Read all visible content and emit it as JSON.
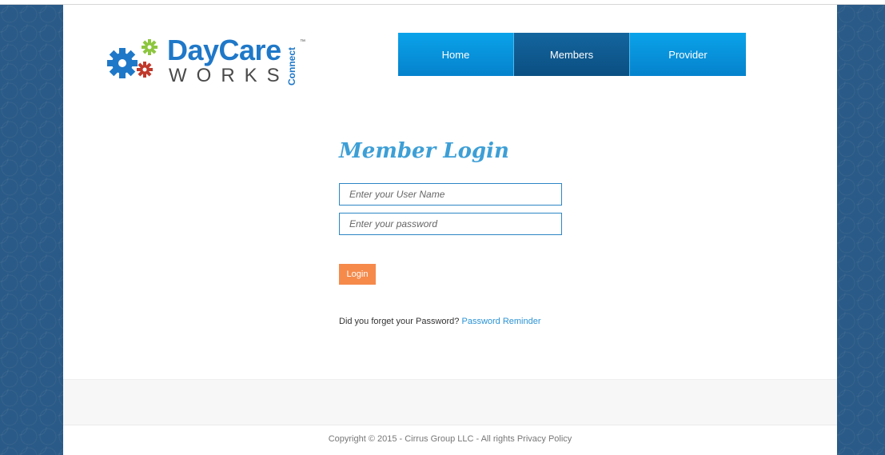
{
  "logo": {
    "brand_top": "DayCare",
    "brand_bottom": "WORKS",
    "brand_side": "Connect",
    "trademark": "™"
  },
  "nav": {
    "items": [
      {
        "label": "Home",
        "active": false
      },
      {
        "label": "Members",
        "active": true
      },
      {
        "label": "Provider",
        "active": false
      }
    ]
  },
  "login": {
    "title": "Member Login",
    "username_placeholder": "Enter your User Name",
    "username_value": "",
    "password_placeholder": "Enter your password",
    "password_value": "",
    "button_label": "Login",
    "forgot_text": "Did you forget your Password?",
    "reminder_link": "Password Reminder"
  },
  "footer": {
    "copyright": "Copyright © 2015 - Cirrus Group LLC - All rights",
    "privacy_link": "Privacy Policy"
  },
  "colors": {
    "brand_blue": "#1f78c8",
    "nav_blue": "#0aa3ea",
    "nav_active": "#0a4f82",
    "title_blue": "#3d9fd6",
    "button_orange": "#f58a4b",
    "side_background": "#2a5a87",
    "gear_green": "#8dc63f",
    "gear_red": "#c0392b"
  }
}
